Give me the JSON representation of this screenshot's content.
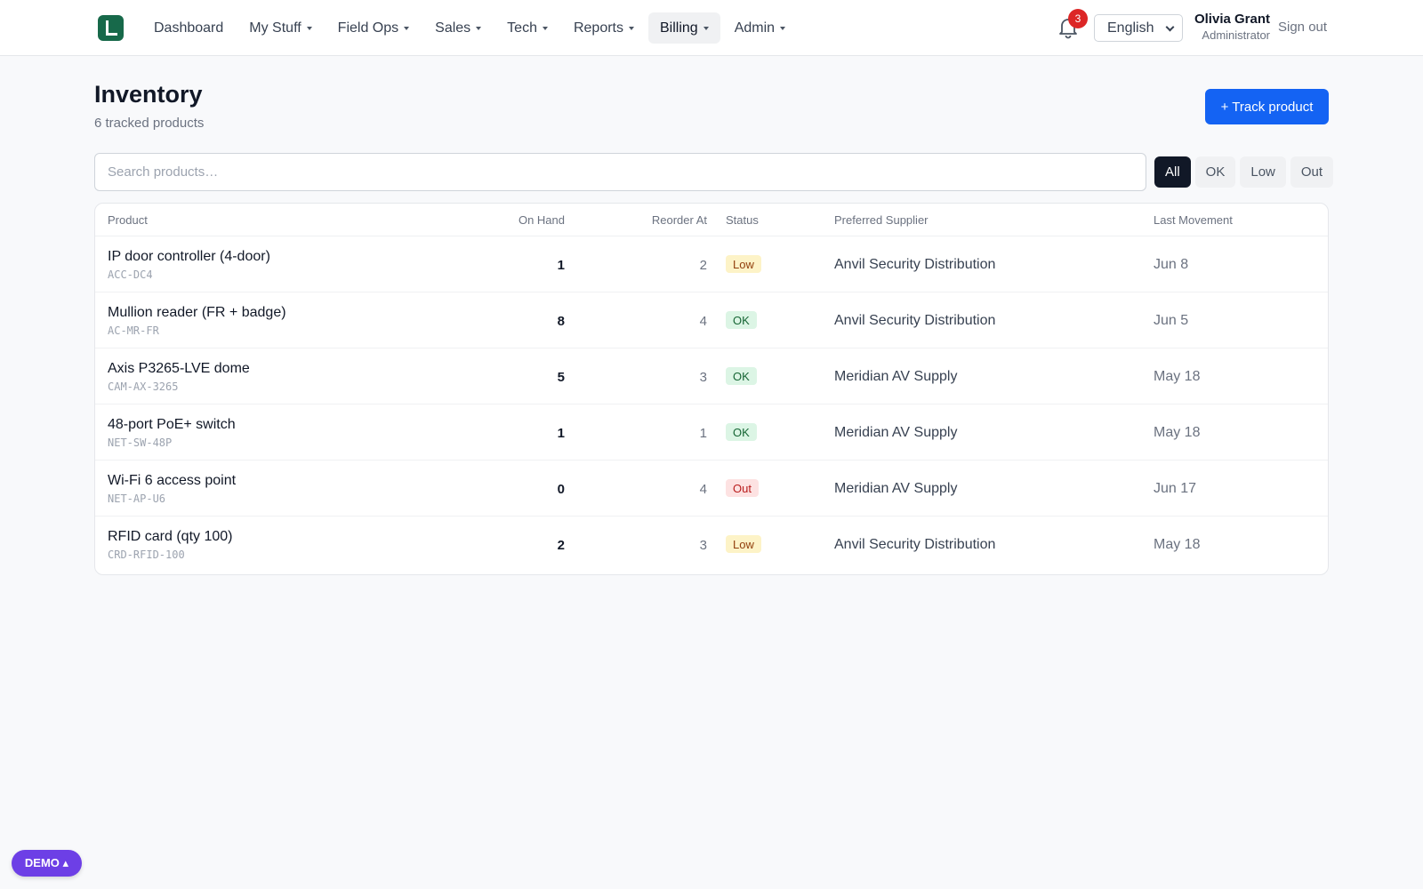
{
  "nav": {
    "items": [
      {
        "label": "Dashboard",
        "dropdown": false,
        "active": false
      },
      {
        "label": "My Stuff",
        "dropdown": true,
        "active": false
      },
      {
        "label": "Field Ops",
        "dropdown": true,
        "active": false
      },
      {
        "label": "Sales",
        "dropdown": true,
        "active": false
      },
      {
        "label": "Tech",
        "dropdown": true,
        "active": false
      },
      {
        "label": "Reports",
        "dropdown": true,
        "active": false
      },
      {
        "label": "Billing",
        "dropdown": true,
        "active": true
      },
      {
        "label": "Admin",
        "dropdown": true,
        "active": false
      }
    ],
    "notifications_count": "3",
    "language": "English",
    "user_name": "Olivia Grant",
    "user_role": "Administrator",
    "sign_out": "Sign out"
  },
  "page": {
    "title": "Inventory",
    "subtitle": "6 tracked products",
    "track_button": "+ Track product",
    "search_placeholder": "Search products…",
    "filters": [
      {
        "label": "All",
        "active": true
      },
      {
        "label": "OK",
        "active": false
      },
      {
        "label": "Low",
        "active": false
      },
      {
        "label": "Out",
        "active": false
      }
    ]
  },
  "table": {
    "headers": {
      "product": "Product",
      "on_hand": "On Hand",
      "reorder_at": "Reorder At",
      "status": "Status",
      "supplier": "Preferred Supplier",
      "last_movement": "Last Movement"
    },
    "rows": [
      {
        "name": "IP door controller (4-door)",
        "sku": "ACC-DC4",
        "on_hand": "1",
        "reorder_at": "2",
        "status": "Low",
        "supplier": "Anvil Security Distribution",
        "last_movement": "Jun 8"
      },
      {
        "name": "Mullion reader (FR + badge)",
        "sku": "AC-MR-FR",
        "on_hand": "8",
        "reorder_at": "4",
        "status": "OK",
        "supplier": "Anvil Security Distribution",
        "last_movement": "Jun 5"
      },
      {
        "name": "Axis P3265-LVE dome",
        "sku": "CAM-AX-3265",
        "on_hand": "5",
        "reorder_at": "3",
        "status": "OK",
        "supplier": "Meridian AV Supply",
        "last_movement": "May 18"
      },
      {
        "name": "48-port PoE+ switch",
        "sku": "NET-SW-48P",
        "on_hand": "1",
        "reorder_at": "1",
        "status": "OK",
        "supplier": "Meridian AV Supply",
        "last_movement": "May 18"
      },
      {
        "name": "Wi-Fi 6 access point",
        "sku": "NET-AP-U6",
        "on_hand": "0",
        "reorder_at": "4",
        "status": "Out",
        "supplier": "Meridian AV Supply",
        "last_movement": "Jun 17"
      },
      {
        "name": "RFID card (qty 100)",
        "sku": "CRD-RFID-100",
        "on_hand": "2",
        "reorder_at": "3",
        "status": "Low",
        "supplier": "Anvil Security Distribution",
        "last_movement": "May 18"
      }
    ]
  },
  "demo_badge": "DEMO ▴",
  "colors": {
    "brand": "#17694a",
    "primary": "#1463f3",
    "status_low": "#fdf3c7",
    "status_ok": "#dcf5e5",
    "status_out": "#fde2e2",
    "demo": "#6d3fe6"
  },
  "icons": {
    "logo": "logo-icon",
    "notifications": "bell-icon",
    "language": "chevron-down-icon"
  }
}
